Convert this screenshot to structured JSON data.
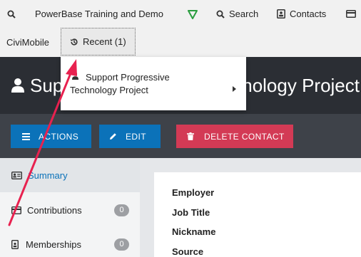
{
  "topbar": {
    "org_name": "PowerBase Training and Demo",
    "search_label": "Search",
    "contacts_label": "Contacts"
  },
  "row2": {
    "civimobile_label": "CiviMobile",
    "recent_label": "Recent (1)"
  },
  "recent_dropdown": {
    "item_label": "Support Progressive Technology Project"
  },
  "header": {
    "title": "Support Progressive Technology Project"
  },
  "actions": {
    "actions_label": "ACTIONS",
    "edit_label": "EDIT",
    "delete_label": "DELETE CONTACT"
  },
  "sidebar": {
    "items": [
      {
        "label": "Summary",
        "count": ""
      },
      {
        "label": "Contributions",
        "count": "0"
      },
      {
        "label": "Memberships",
        "count": "0"
      }
    ]
  },
  "summary": {
    "fields": [
      "Employer",
      "Job Title",
      "Nickname",
      "Source"
    ]
  },
  "colors": {
    "topbar_bg": "#f1f1f1",
    "header_bg": "#2b2e34",
    "action_bar_bg": "#3e4249",
    "primary_button": "#0b72b9",
    "danger_button": "#d33a55",
    "annotation_arrow": "#e8214f"
  }
}
